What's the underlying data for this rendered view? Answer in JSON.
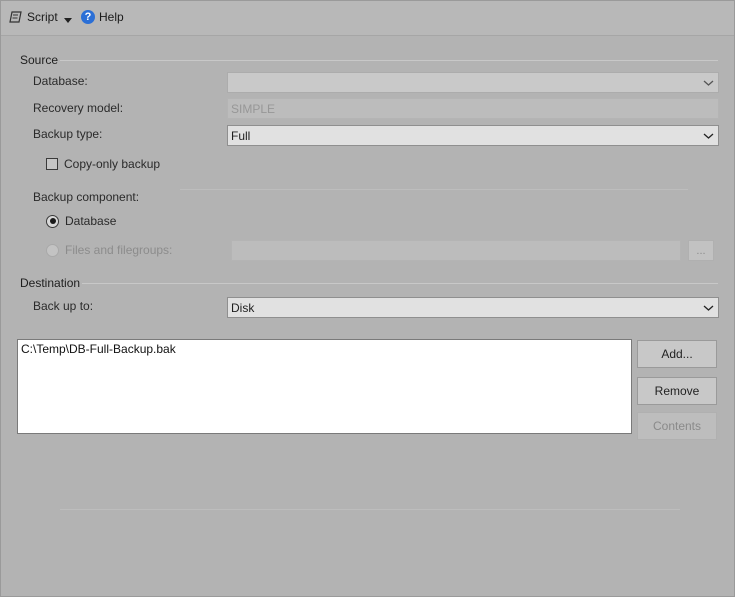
{
  "toolbar": {
    "script_label": "Script",
    "help_label": "Help"
  },
  "source": {
    "title": "Source",
    "database": {
      "label": "Database:",
      "value": ""
    },
    "recovery_model": {
      "label": "Recovery model:",
      "value": "SIMPLE"
    },
    "backup_type": {
      "label": "Backup type:",
      "value": "Full"
    },
    "copy_only": {
      "label": "Copy-only backup",
      "checked": false
    },
    "backup_component": {
      "label": "Backup component:",
      "options": [
        {
          "label": "Database",
          "selected": true,
          "enabled": true
        },
        {
          "label": "Files and filegroups:",
          "selected": false,
          "enabled": false
        }
      ],
      "browse_label": "..."
    }
  },
  "destination": {
    "title": "Destination",
    "back_up_to": {
      "label": "Back up to:",
      "value": "Disk"
    },
    "files": [
      "C:\\Temp\\DB-Full-Backup.bak"
    ],
    "buttons": {
      "add": "Add...",
      "remove": "Remove",
      "contents": "Contents"
    }
  },
  "colors": {
    "accent": "#2b6fd6",
    "panel": "#b3b3b3"
  },
  "icons": {
    "script": "script-icon",
    "dropdown": "chevron-down-icon",
    "help": "help-icon"
  }
}
